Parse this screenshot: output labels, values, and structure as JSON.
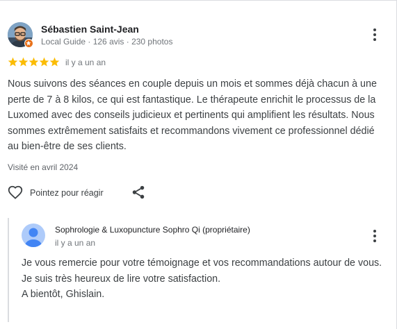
{
  "review": {
    "reviewer_name": "Sébastien Saint-Jean",
    "reviewer_meta": "Local Guide · 126 avis · 230 photos",
    "rating": 5,
    "rating_max": 5,
    "star_color": "#fbbc04",
    "date": "il y a un an",
    "text": "Nous suivons des séances en couple depuis un mois et sommes déjà chacun à une perte de 7 à 8 kilos, ce qui est fantastique. Le thérapeute enrichit le processus de la Luxomed avec des conseils judicieux et pertinents qui amplifient les résultats. Nous sommes extrêmement satisfaits et recommandons vivement ce professionnel dédié au bien-être de ses clients.",
    "visit": "Visité en avril 2024",
    "like_label": "Pointez pour réagir",
    "icons": {
      "avatar": "reviewer-avatar",
      "badge": "local-guide-badge-icon",
      "more": "more-vert-icon",
      "like": "heart-outline-icon",
      "share": "share-icon"
    }
  },
  "owner_reply": {
    "owner_name": "Sophrologie & Luxopuncture Sophro Qi (propriétaire)",
    "date": "il y a un an",
    "lines": [
      "Je vous remercie pour votre témoignage et vos recommandations autour de vous.",
      "Je suis très heureux de lire votre satisfaction.",
      "A bientôt, Ghislain."
    ],
    "avatar_color": "#aecbfa"
  }
}
